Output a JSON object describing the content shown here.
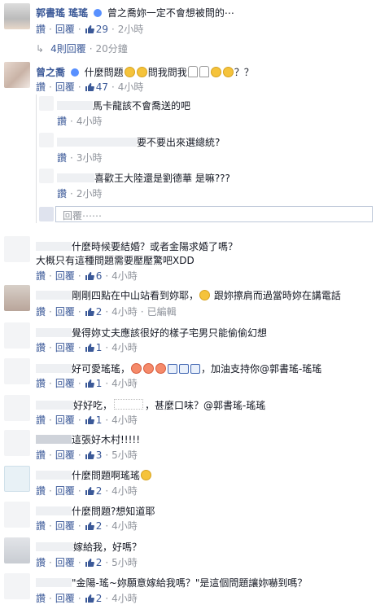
{
  "top_comment": {
    "author": "郭書瑤 瑤瑤",
    "text": "曾之喬妳一定不會想被問的⋯",
    "like_label": "讚",
    "reply_label": "回覆",
    "like_count": "29",
    "time": "2小時",
    "replies_link": "4則回覆",
    "replies_time": "20分鐘"
  },
  "thread": {
    "author": "曾之喬",
    "text_before": "什麼問題",
    "text_middle": "問我問我",
    "text_after": "？？",
    "like_label": "讚",
    "reply_label": "回覆",
    "like_count": "47",
    "time": "4小時",
    "replies": [
      {
        "text": "馬卡龍該不會喬送的吧",
        "like_label": "讚",
        "time": "4小時"
      },
      {
        "text": "要不要出來選總統?",
        "like_label": "讚",
        "time": "3小時"
      },
      {
        "text": "喜歡王大陸還是劉德華 是嘛???",
        "like_label": "讚",
        "time": "2小時"
      }
    ],
    "reply_placeholder": "回覆⋯⋯"
  },
  "comments": [
    {
      "line1": "什麼時候要結婚？或者金陽求婚了嗎？",
      "line2": "大概只有這種問題需要壓壓驚吧XDD",
      "like_label": "讚",
      "reply_label": "回覆",
      "like_count": "6",
      "time": "4小時",
      "extra": ""
    },
    {
      "line1": "剛剛四點在中山站看到妳耶，",
      "line1b": "跟妳擦肩而過當時妳在講電話",
      "like_label": "讚",
      "reply_label": "回覆",
      "like_count": "2",
      "time": "4小時",
      "extra": "已編輯"
    },
    {
      "line1": "覺得妳丈夫應該很好的樣子宅男只能偷偷幻想",
      "like_label": "讚",
      "reply_label": "回覆",
      "like_count": "1",
      "time": "4小時",
      "extra": ""
    },
    {
      "line1": "好可愛瑤瑤，",
      "line1b": "，加油支持你@郭書瑤-瑤瑤",
      "like_label": "讚",
      "reply_label": "回覆",
      "like_count": "1",
      "time": "4小時",
      "extra": ""
    },
    {
      "line1": "好好吃，",
      "line1b": "，甚麼口味？@郭書瑤-瑤瑤",
      "like_label": "讚",
      "reply_label": "回覆",
      "like_count": "1",
      "time": "4小時",
      "extra": ""
    },
    {
      "line1": "這張好木村!!!!!",
      "like_label": "讚",
      "reply_label": "回覆",
      "like_count": "3",
      "time": "5小時",
      "extra": ""
    },
    {
      "line1": "什麼問題啊瑤瑤",
      "like_label": "讚",
      "reply_label": "回覆",
      "like_count": "2",
      "time": "4小時",
      "extra": ""
    },
    {
      "line1": "什麼問題?想知道耶",
      "like_label": "讚",
      "reply_label": "回覆",
      "like_count": "2",
      "time": "4小時",
      "extra": ""
    },
    {
      "line1": "嫁給我，好嗎？",
      "like_label": "讚",
      "reply_label": "回覆",
      "like_count": "2",
      "time": "5小時",
      "extra": ""
    },
    {
      "line1": "\"金陽-瑤~妳願意嫁給我嗎？\"是這個問題讓妳嚇到嗎？",
      "like_label": "讚",
      "reply_label": "回覆",
      "like_count": "2",
      "time": "4小時",
      "extra": ""
    }
  ],
  "colors": {
    "link": "#3b5998",
    "meta": "#90949c",
    "text": "#141823"
  }
}
